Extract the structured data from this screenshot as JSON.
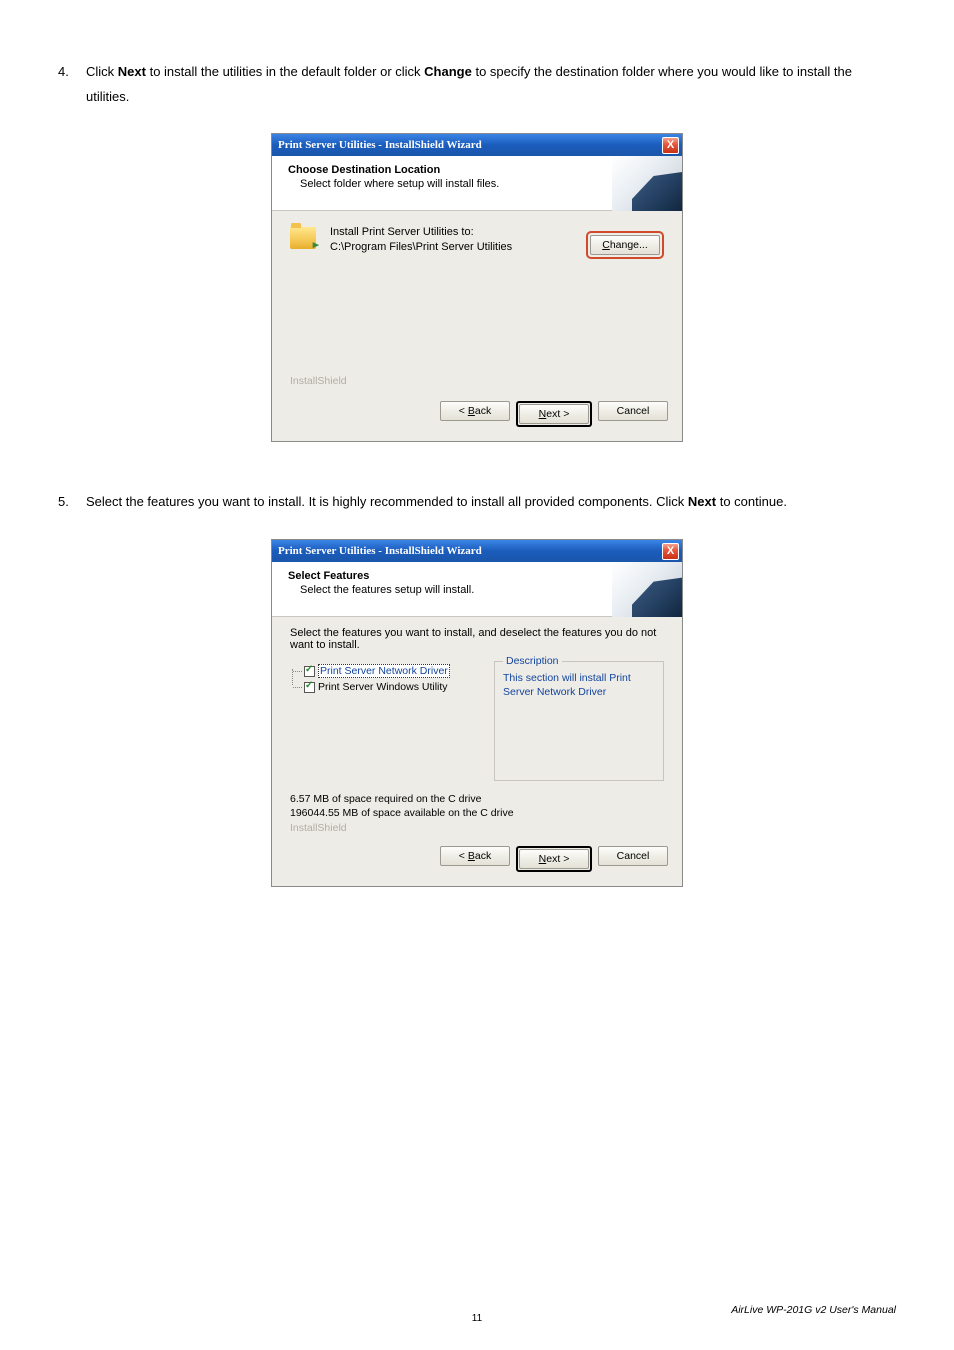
{
  "step4": {
    "num": "4.",
    "prefix": "Click ",
    "bold1": "Next",
    "mid": " to install the utilities in the default folder or click ",
    "bold2": "Change",
    "suffix": " to specify the destination folder where you would like to install the utilities."
  },
  "step5": {
    "num": "5.",
    "prefix": "Select the features you want to install. It is highly recommended to install all provided components. Click ",
    "bold1": "Next",
    "suffix": " to continue."
  },
  "dialog1": {
    "title": "Print Server Utilities - InstallShield Wizard",
    "close": "X",
    "header_title": "Choose Destination Location",
    "header_sub": "Select folder where setup will install files.",
    "install_to_label": "Install Print Server Utilities to:",
    "install_path": "C:\\Program Files\\Print Server Utilities",
    "change_btn": {
      "u": "C",
      "rest": "hange..."
    },
    "brand": "InstallShield",
    "back": {
      "pre": "< ",
      "u": "B",
      "rest": "ack"
    },
    "next": {
      "u": "N",
      "rest": "ext >"
    },
    "cancel": "Cancel"
  },
  "dialog2": {
    "title": "Print Server Utilities - InstallShield Wizard",
    "close": "X",
    "header_title": "Select Features",
    "header_sub": "Select the features setup will install.",
    "instruction": "Select the features you want to install, and deselect the features you do not want to install.",
    "feat1": "Print Server Network Driver",
    "feat2": "Print Server Windows Utility",
    "desc_title": "Description",
    "desc_body": "This section will install Print Server Network Driver",
    "space1": "6.57 MB of space required on the C drive",
    "space2": "196044.55 MB of space available on the C drive",
    "brand": "InstallShield",
    "back": {
      "pre": "< ",
      "u": "B",
      "rest": "ack"
    },
    "next": {
      "u": "N",
      "rest": "ext >"
    },
    "cancel": "Cancel"
  },
  "footer": {
    "page": "11",
    "manual": "AirLive WP-201G v2 User's Manual"
  }
}
